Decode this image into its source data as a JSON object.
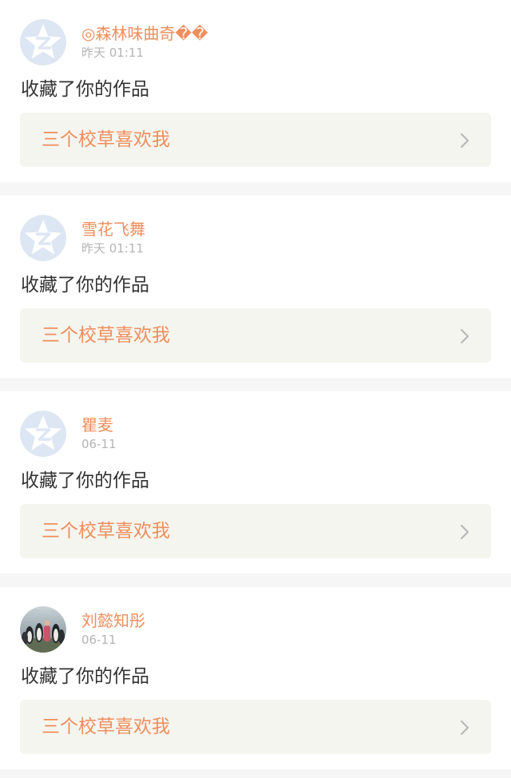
{
  "colors": {
    "accent": "#ef8e5d",
    "text": "#333333",
    "muted": "#b4b4b4",
    "work_bg": "#f5f5ef",
    "page_bg": "#f6f6f6",
    "default_avatar_bg": "#dde6f3",
    "default_avatar_star": "#ffffff"
  },
  "notifications": [
    {
      "user": "◎森林味曲奇��",
      "time": "昨天 01:11",
      "action": "收藏了你的作品",
      "work_title": "三个校草喜欢我",
      "avatar": "default-qzone-avatar-icon",
      "chevron": "chevron-right-icon"
    },
    {
      "user": "雪花飞舞",
      "time": "昨天 01:11",
      "action": "收藏了你的作品",
      "work_title": "三个校草喜欢我",
      "avatar": "default-qzone-avatar-icon",
      "chevron": "chevron-right-icon"
    },
    {
      "user": "瞿麦",
      "time": "06-11",
      "action": "收藏了你的作品",
      "work_title": "三个校草喜欢我",
      "avatar": "default-qzone-avatar-icon",
      "chevron": "chevron-right-icon"
    },
    {
      "user": "刘懿知彤",
      "time": "06-11",
      "action": "收藏了你的作品",
      "work_title": "三个校草喜欢我",
      "avatar": "penguin-photo-avatar",
      "chevron": "chevron-right-icon"
    }
  ]
}
